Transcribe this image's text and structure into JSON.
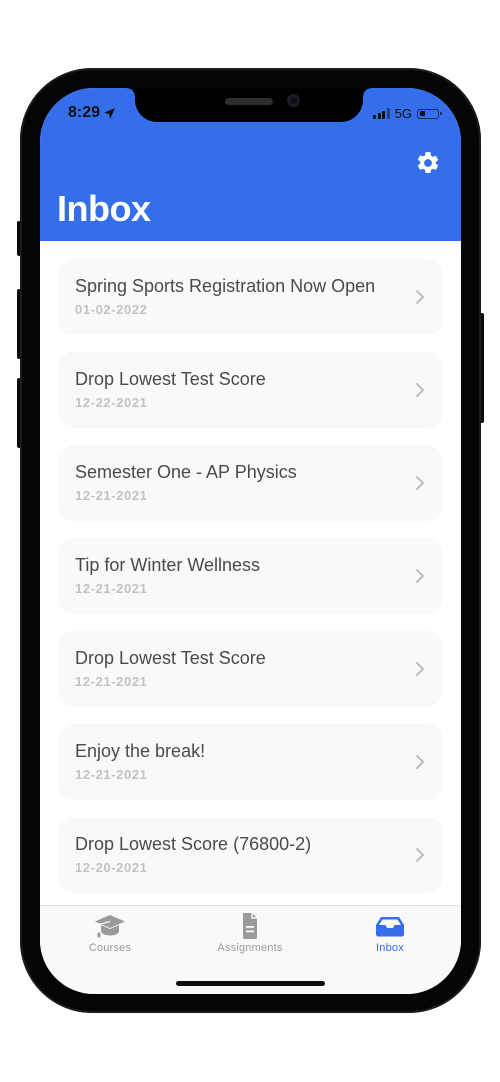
{
  "status_bar": {
    "time": "8:29",
    "network": "5G",
    "battery_level": 0.3,
    "icons": [
      "location-arrow-icon",
      "signal-icon",
      "battery-icon"
    ]
  },
  "header": {
    "title": "Inbox",
    "settings_icon": "gear-icon",
    "color": "#346eeb"
  },
  "messages": [
    {
      "title": "Spring Sports Registration Now Open",
      "date": "01-02-2022"
    },
    {
      "title": "Drop Lowest Test Score",
      "date": "12-22-2021"
    },
    {
      "title": "Semester One - AP Physics",
      "date": "12-21-2021"
    },
    {
      "title": "Tip for Winter Wellness",
      "date": "12-21-2021"
    },
    {
      "title": "Drop Lowest Test Score",
      "date": "12-21-2021"
    },
    {
      "title": "Enjoy the break!",
      "date": "12-21-2021"
    },
    {
      "title": "Drop Lowest Score (76800-2)",
      "date": "12-20-2021"
    }
  ],
  "tab_bar": {
    "tabs": [
      {
        "label": "Courses",
        "icon": "graduation-cap-icon",
        "active": false
      },
      {
        "label": "Assignments",
        "icon": "document-icon",
        "active": false
      },
      {
        "label": "Inbox",
        "icon": "inbox-tray-icon",
        "active": true
      }
    ],
    "active_color": "#346eeb",
    "inactive_color": "#9a9a9a"
  }
}
